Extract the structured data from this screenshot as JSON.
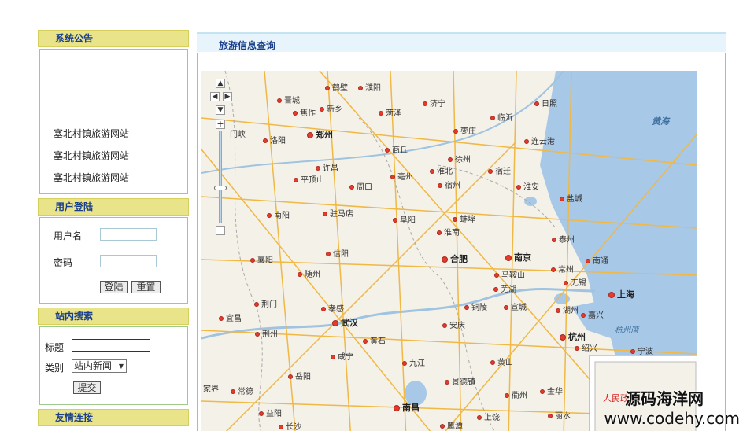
{
  "sidebar": {
    "notice": {
      "title": "系统公告",
      "items": [
        "塞北村镇旅游网站",
        "塞北村镇旅游网站",
        "塞北村镇旅游网站"
      ]
    },
    "login": {
      "title": "用户登陆",
      "username_label": "用户名",
      "password_label": "密码",
      "login_button": "登陆",
      "reset_button": "重置"
    },
    "search": {
      "title": "站内搜索",
      "title_label": "标题",
      "category_label": "类别",
      "category_value": "站内新闻",
      "submit_button": "提交"
    },
    "links": {
      "title": "友情连接"
    }
  },
  "main": {
    "title": "旅游信息查询"
  },
  "map": {
    "sea_label": "黄海",
    "bay_label": "杭州湾",
    "inset_text": "人民政府",
    "cities": [
      "鹤壁",
      "濮阳",
      "晋城",
      "新乡",
      "焦作",
      "菏泽",
      "济宁",
      "日照",
      "门峡",
      "洛阳",
      "郑州",
      "枣庄",
      "临沂",
      "商丘",
      "连云港",
      "徐州",
      "许昌",
      "平顶山",
      "亳州",
      "淮北",
      "宿迁",
      "周口",
      "宿州",
      "淮安",
      "盐城",
      "南阳",
      "驻马店",
      "阜阳",
      "蚌埠",
      "淮南",
      "泰州",
      "襄阳",
      "信阳",
      "合肥",
      "南京",
      "南通",
      "随州",
      "马鞍山",
      "常州",
      "无锡",
      "芜湖",
      "上海",
      "荆门",
      "孝感",
      "铜陵",
      "宣城",
      "湖州",
      "嘉兴",
      "宜昌",
      "荆州",
      "武汉",
      "安庆",
      "杭州",
      "绍兴",
      "黄石",
      "咸宁",
      "黄山",
      "宁波",
      "岳阳",
      "九江",
      "常德",
      "益阳",
      "长沙",
      "景德镇",
      "衢州",
      "金华",
      "南昌",
      "鹰潭",
      "丽水",
      "上饶",
      "家界"
    ],
    "colors": {
      "land": "#f4f1e8",
      "water": "#a8c8e8",
      "road": "#f2c55a",
      "highway": "#f0a830"
    }
  },
  "watermark": {
    "line1": "源码海洋网",
    "line2": "www.codehy.com"
  }
}
